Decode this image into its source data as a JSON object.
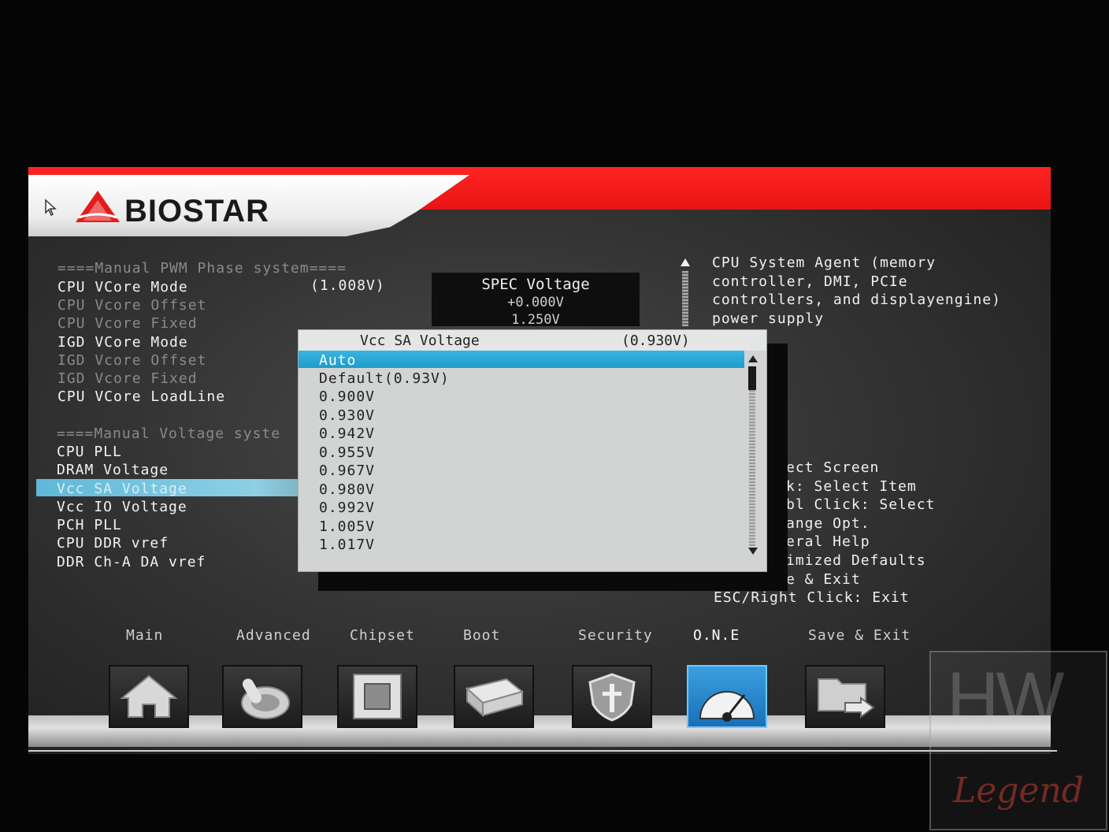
{
  "brand": {
    "logo_text": "BIOSTAR"
  },
  "settings": {
    "section1_header": "====Manual PWM Phase system====",
    "section1_items": [
      {
        "label": "CPU VCore Mode",
        "value": "(1.008V)",
        "enabled": true
      },
      {
        "label": "CPU Vcore Offset",
        "enabled": false
      },
      {
        "label": "CPU Vcore Fixed",
        "enabled": false
      },
      {
        "label": "IGD VCore Mode",
        "enabled": true
      },
      {
        "label": "IGD Vcore Offset",
        "enabled": false
      },
      {
        "label": "IGD Vcore Fixed",
        "enabled": false
      },
      {
        "label": "CPU VCore LoadLine",
        "enabled": true
      }
    ],
    "section2_header": "====Manual Voltage syste",
    "section2_items": [
      {
        "label": "CPU PLL"
      },
      {
        "label": "DRAM Voltage"
      },
      {
        "label": "Vcc SA Voltage",
        "selected": true
      },
      {
        "label": "Vcc IO Voltage"
      },
      {
        "label": "PCH PLL"
      },
      {
        "label": "CPU DDR vref"
      },
      {
        "label": "DDR Ch-A DA vref"
      }
    ]
  },
  "spec": {
    "title": "SPEC Voltage",
    "values": [
      "+0.000V",
      "1.250V"
    ]
  },
  "help": {
    "description": "CPU System Agent (memory controller, DMI, PCIe controllers, and displayengine) power supply",
    "keys": [
      "ect Screen",
      "k: Select Item",
      "bl Click: Select",
      "ange Opt.",
      "eral Help",
      "imized Defaults",
      "e & Exit",
      "ESC/Right Click: Exit"
    ]
  },
  "popup": {
    "title": "Vcc SA Voltage",
    "current": "(0.930V)",
    "options": [
      "Auto",
      "Default(0.93V)",
      "0.900V",
      "0.930V",
      "0.942V",
      "0.955V",
      "0.967V",
      "0.980V",
      "0.992V",
      "1.005V",
      "1.017V"
    ],
    "selected_index": 0
  },
  "tabs": [
    {
      "label": "Main",
      "icon": "home-icon"
    },
    {
      "label": "Advanced",
      "icon": "joystick-icon"
    },
    {
      "label": "Chipset",
      "icon": "chip-icon"
    },
    {
      "label": "Boot",
      "icon": "drive-icon"
    },
    {
      "label": "Security",
      "icon": "shield-icon"
    },
    {
      "label": "O.N.E",
      "icon": "gauge-icon",
      "active": true
    },
    {
      "label": "Save & Exit",
      "icon": "folder-exit-icon"
    }
  ],
  "watermark": {
    "mark": "HW",
    "word": "Legend"
  },
  "colors": {
    "header_red": "#e81414",
    "highlight_blue": "#1e9ccc",
    "selected_row": "#8ed0e4"
  }
}
